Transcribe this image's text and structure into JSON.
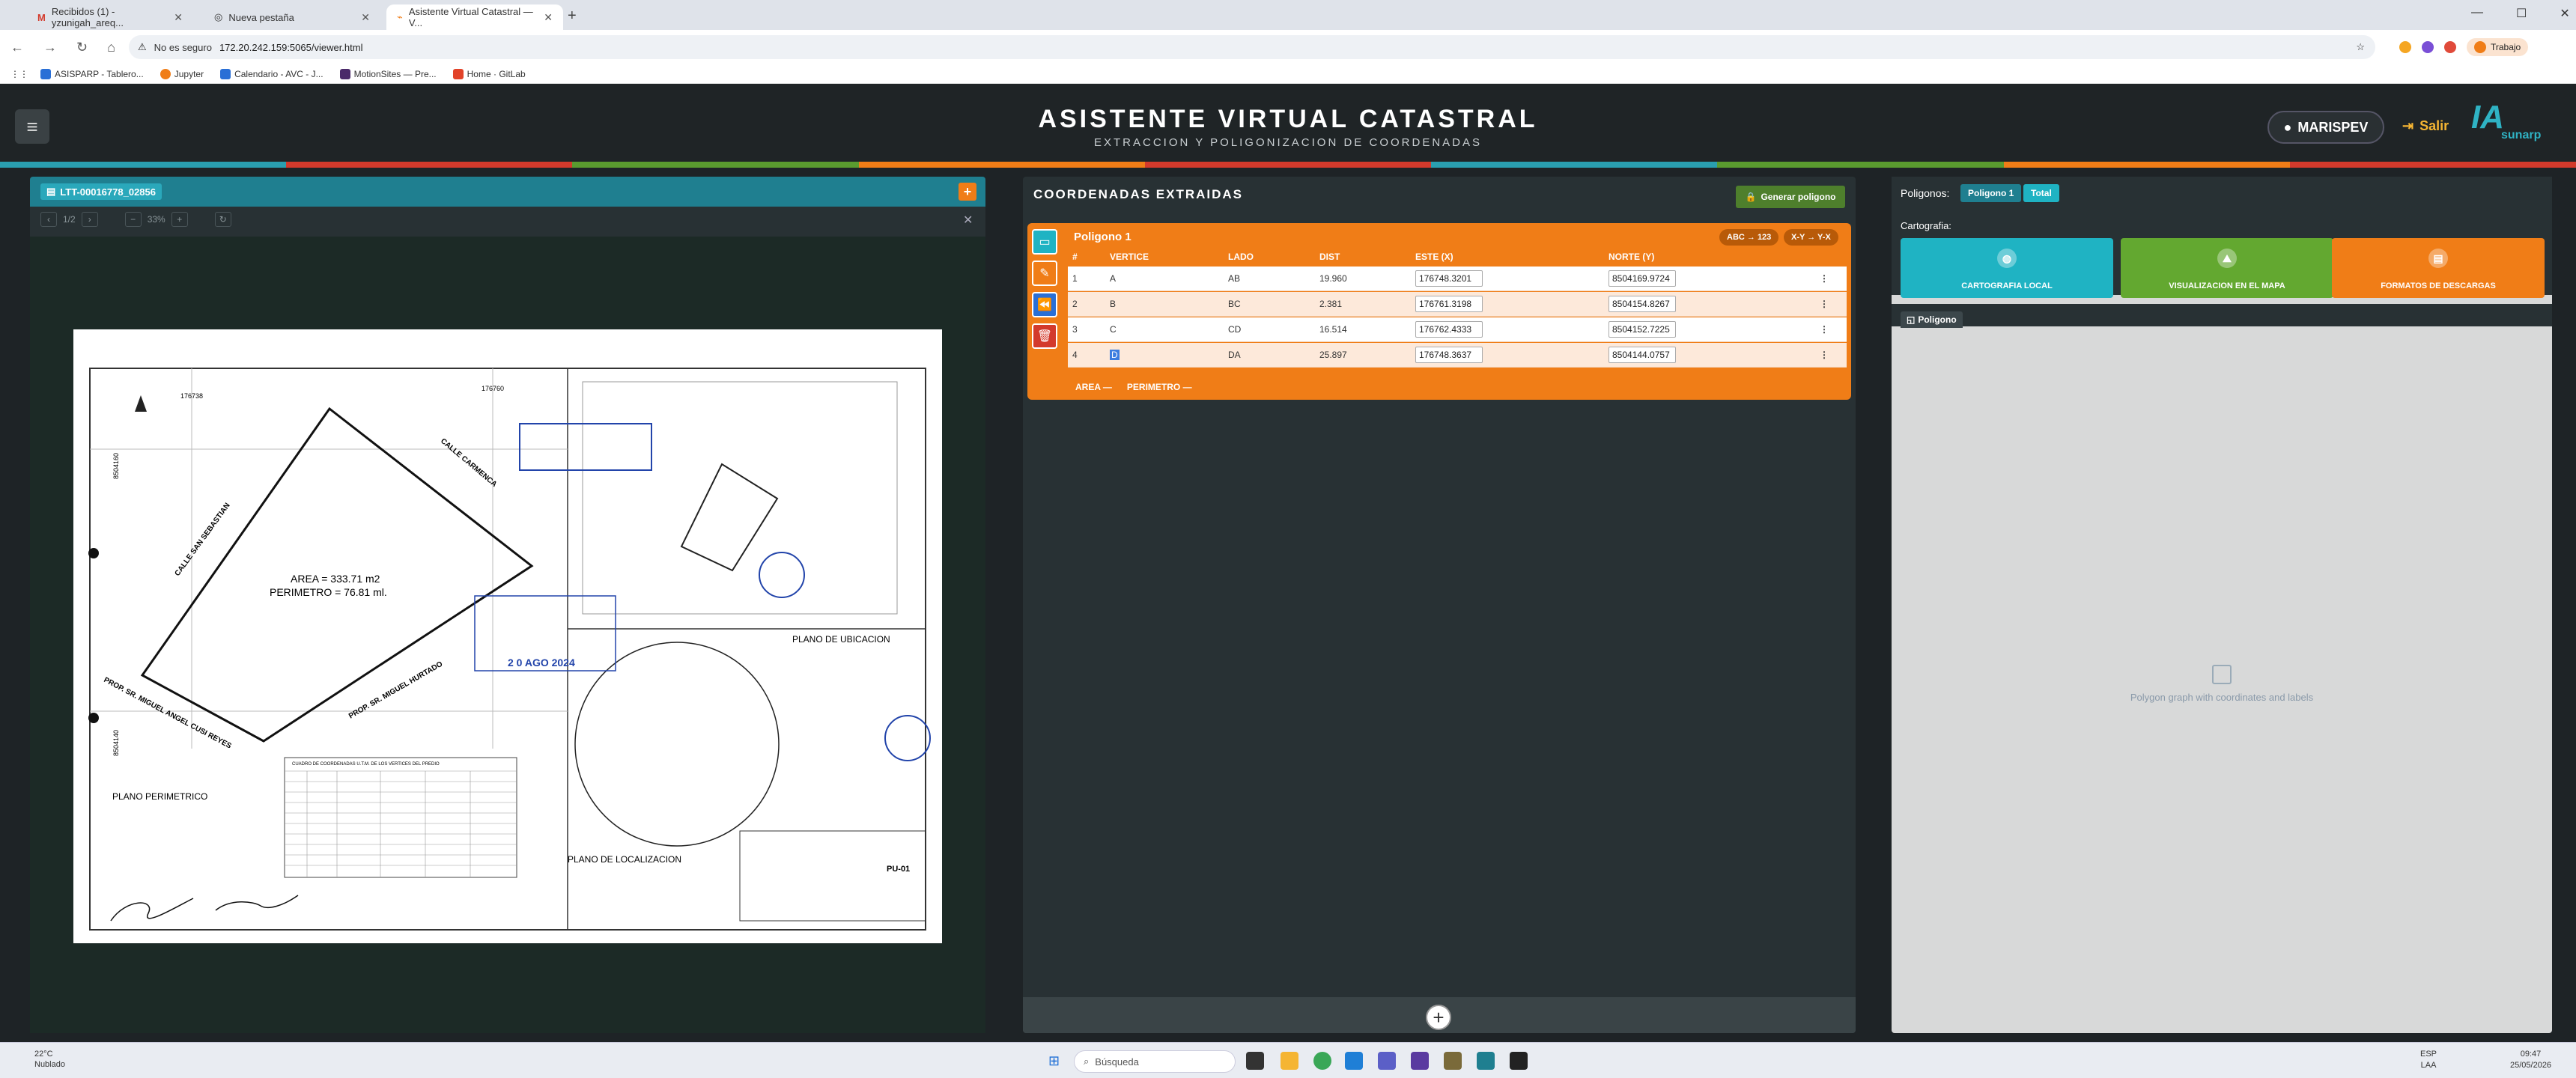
{
  "browser": {
    "tabs": [
      {
        "title": "Recibidos (1) - yzunigah_areq..."
      },
      {
        "title": "Nueva pestaña"
      },
      {
        "title": "Asistente Virtual Catastral — V..."
      }
    ],
    "security_label": "No es seguro",
    "url": "172.20.242.159:5065/viewer.html",
    "profile": "Trabajo",
    "bookmarks": [
      "ASISPARP - Tablero...",
      "Jupyter",
      "Calendario - AVC - J...",
      "MotionSites — Pre...",
      "Home · GitLab"
    ]
  },
  "header": {
    "title": "ASISTENTE VIRTUAL CATASTRAL",
    "subtitle": "EXTRACCION Y POLIGONIZACION DE COORDENADAS",
    "user": "MARISPEV",
    "logout": "Salir",
    "logo_text": "IA",
    "logo_sub": "sunarp",
    "stripe_colors": [
      "#2a9fb0",
      "#d33a2c",
      "#5a9b2f",
      "#f07d17",
      "#d33a2c",
      "#2a9fb0",
      "#5a9b2f",
      "#f07d17",
      "#d33a2c"
    ]
  },
  "document": {
    "tab_label": "LTT-00016778_02856",
    "page_indicator": "1/2",
    "zoom": "33%",
    "plan": {
      "area": "AREA = 333.71 m2",
      "perimeter": "PERIMETRO = 76.81 ml.",
      "street1": "CALLE SAN SEBASTIAN",
      "street2": "CALLE CARMENCA",
      "prop1": "PROP. SR. MIGUEL HURTADO",
      "prop2": "PROP. SR. MIGUEL ANGEL CUSI REYES",
      "title_perimetrico": "PLANO PERIMETRICO",
      "title_ubicacion": "PLANO DE UBICACION",
      "title_localizacion": "PLANO DE LOCALIZACION",
      "table_title": "CUADRO DE COORDENADAS U.T.M. DE LOS VERTICES DEL PREDIO",
      "stamp_date": "2 0 AGO 2024",
      "sheet": "PU-01",
      "coord_x1": "176738",
      "coord_x2": "176760",
      "coord_y1": "8504160",
      "coord_y2": "8504140"
    }
  },
  "coords": {
    "title": "COORDENADAS EXTRAIDAS",
    "generate": "Generar poligono",
    "polygon_name": "Poligono 1",
    "pill1": "ABC → 123",
    "pill2": "X-Y → Y-X",
    "columns": [
      "#",
      "VERTICE",
      "LADO",
      "DIST",
      "ESTE (X)",
      "NORTE (Y)"
    ],
    "rows": [
      {
        "n": "1",
        "v": "A",
        "lado": "AB",
        "dist": "19.960",
        "este": "176748.3201",
        "norte": "8504169.9724"
      },
      {
        "n": "2",
        "v": "B",
        "lado": "BC",
        "dist": "2.381",
        "este": "176761.3198",
        "norte": "8504154.8267"
      },
      {
        "n": "3",
        "v": "C",
        "lado": "CD",
        "dist": "16.514",
        "este": "176762.4333",
        "norte": "8504152.7225"
      },
      {
        "n": "4",
        "v": "D",
        "lado": "DA",
        "dist": "25.897",
        "este": "176748.3637",
        "norte": "8504144.0757"
      }
    ],
    "area_label": "AREA —",
    "perimeter_label": "PERIMETRO —"
  },
  "right": {
    "polygons_label": "Poligonos:",
    "tab_poly": "Poligono 1",
    "tab_total": "Total",
    "cartografia": "Cartografia:",
    "cards": [
      {
        "label": "CARTOGRAFIA LOCAL",
        "color": "#1fb3c3",
        "icon": "globe-icon"
      },
      {
        "label": "VISUALIZACION EN EL MAPA",
        "color": "#63a830",
        "icon": "map-icon"
      },
      {
        "label": "FORMATOS DE DESCARGAS",
        "color": "#f07d17",
        "icon": "file-icon"
      }
    ],
    "subtab": "Poligono",
    "placeholder": "Polygon graph with coordinates and labels"
  },
  "taskbar": {
    "temp": "22°C",
    "weather": "Nublado",
    "search": "Búsqueda",
    "lang1": "ESP",
    "lang2": "LAA",
    "time": "09:47",
    "date": "25/05/2026"
  }
}
